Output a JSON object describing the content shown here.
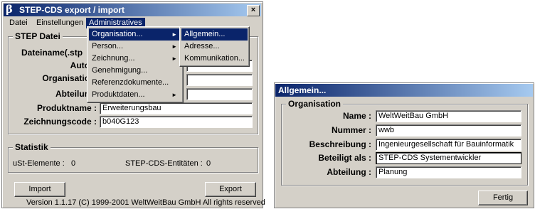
{
  "main_window": {
    "title": "STEP-CDS export / import",
    "close_label": "×",
    "menubar": [
      "Datei",
      "Einstellungen",
      "Administratives"
    ],
    "step_group": {
      "title": "STEP Datei",
      "labels": [
        "Dateiname(.stp",
        "Auto",
        "Organisatio",
        "Abteilun",
        "Produktname :",
        "Zeichnungscode :"
      ],
      "produktname_value": "Erweiterungsbau",
      "zeichnungscode_value": "b040G123"
    },
    "stats_group": {
      "title": "Statistik",
      "ust_label": "uSt-Elemente :",
      "ust_value": "0",
      "cds_label": "STEP-CDS-Entitäten :",
      "cds_value": "0"
    },
    "import_label": "Import",
    "export_label": "Export",
    "version_text": "Version 1.1.17  (C) 1999-2001 WeltWeitBau GmbH All rights reserved"
  },
  "admin_menu": {
    "items": [
      "Organisation...",
      "Person...",
      "Zeichnung...",
      "Genehmigung...",
      "Referenzdokumente...",
      "Produktdaten..."
    ],
    "submenu_arrow": "►"
  },
  "org_submenu": {
    "items": [
      "Allgemein...",
      "Adresse...",
      "Kommunikation..."
    ]
  },
  "allgemein_dialog": {
    "title": "Allgemein...",
    "group_title": "Organisation",
    "fields": [
      {
        "label": "Name :",
        "value": "WeltWeitBau GmbH"
      },
      {
        "label": "Nummer :",
        "value": "wwb"
      },
      {
        "label": "Beschreibung :",
        "value": "Ingenieurgesellschaft für Bauinformatik"
      },
      {
        "label": "Beteiligt als :",
        "value": "STEP-CDS Systementwickler"
      },
      {
        "label": "Abteilung :",
        "value": "Planung"
      }
    ],
    "fertig_label": "Fertig"
  }
}
